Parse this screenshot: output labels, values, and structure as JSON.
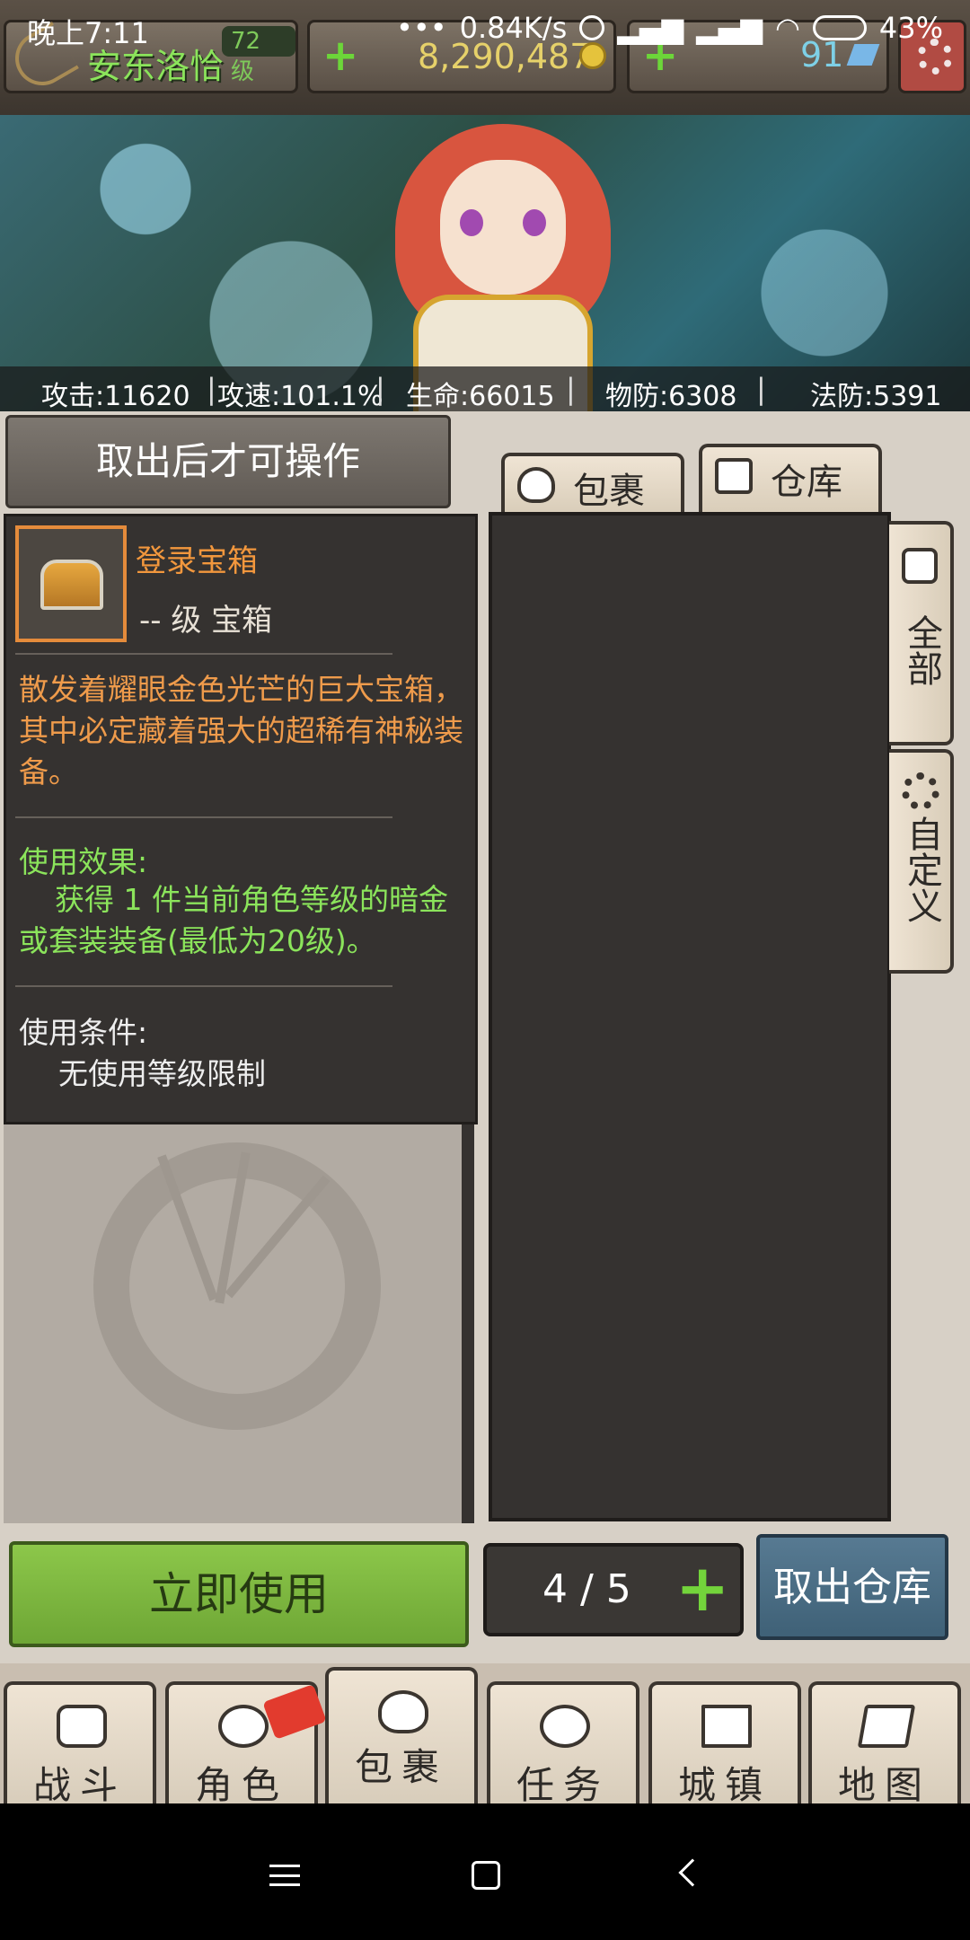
{
  "status_bar": {
    "time": "晚上7:11",
    "network_speed": "0.84K/s",
    "battery": "43%"
  },
  "player": {
    "name": "安东洛恰",
    "level": "72 级",
    "gold": "8,290,487",
    "gems": "91"
  },
  "stats": {
    "attack": "攻击:11620",
    "attack_speed": "攻速:101.1%",
    "hp": "生命:66015",
    "phys_def": "物防:6308",
    "magic_def": "法防:5391"
  },
  "notice": "取出后才可操作",
  "item": {
    "name": "登录宝箱",
    "level_type": "-- 级 宝箱",
    "description": "散发着耀眼金色光芒的巨大宝箱，其中必定藏着强大的超稀有神秘装备。",
    "effect_title": "使用效果:",
    "effect_body": "获得 1 件当前角色等级的暗金或套装装备(最低为20级)。",
    "condition_title": "使用条件:",
    "condition_body": "无使用等级限制"
  },
  "tabs": {
    "bag": "包裹",
    "storage": "仓库"
  },
  "side_tabs": {
    "all": "全部",
    "custom": "自定义"
  },
  "actions": {
    "use_now": "立即使用",
    "count": "4 / 5",
    "take_out": "取出仓库"
  },
  "nav": {
    "battle": "战斗",
    "character": "角色",
    "bag": "包裹",
    "quest": "任务",
    "town": "城镇",
    "map": "地图"
  },
  "colors": {
    "item_name": "#f2973d",
    "effect_text": "#8be45b",
    "use_button": "#7bb63e",
    "take_out_button": "#4b6d84"
  }
}
